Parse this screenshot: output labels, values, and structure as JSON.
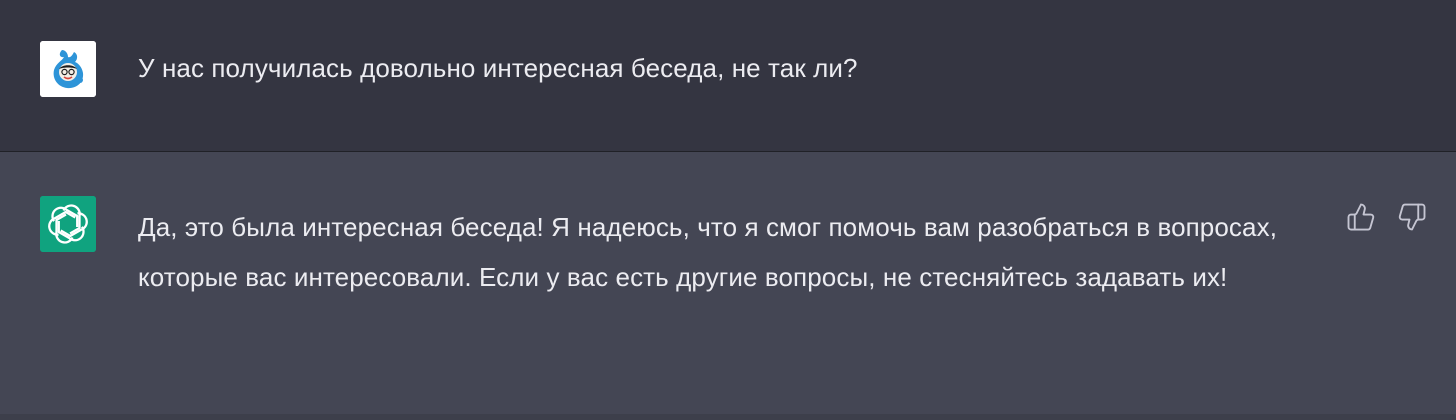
{
  "conversation": {
    "user_message": {
      "avatar_icon": "user-avatar-icon",
      "text": "У нас получилась довольно интересная беседа, не так ли?"
    },
    "assistant_message": {
      "avatar_icon": "openai-logo-icon",
      "text": "Да, это была интересная беседа! Я надеюсь, что я смог помочь вам разобраться в вопросах, которые вас интересовали. Если у вас есть другие вопросы, не стесняйтесь задавать их!",
      "feedback": {
        "like_icon": "thumbs-up-icon",
        "dislike_icon": "thumbs-down-icon"
      }
    }
  },
  "colors": {
    "user_background": "#343541",
    "assistant_background": "#444654",
    "text": "#ececf1",
    "bot_avatar": "#10a37f",
    "user_avatar_figure": "#2d94d8",
    "feedback_icon": "#c5c5d2"
  }
}
